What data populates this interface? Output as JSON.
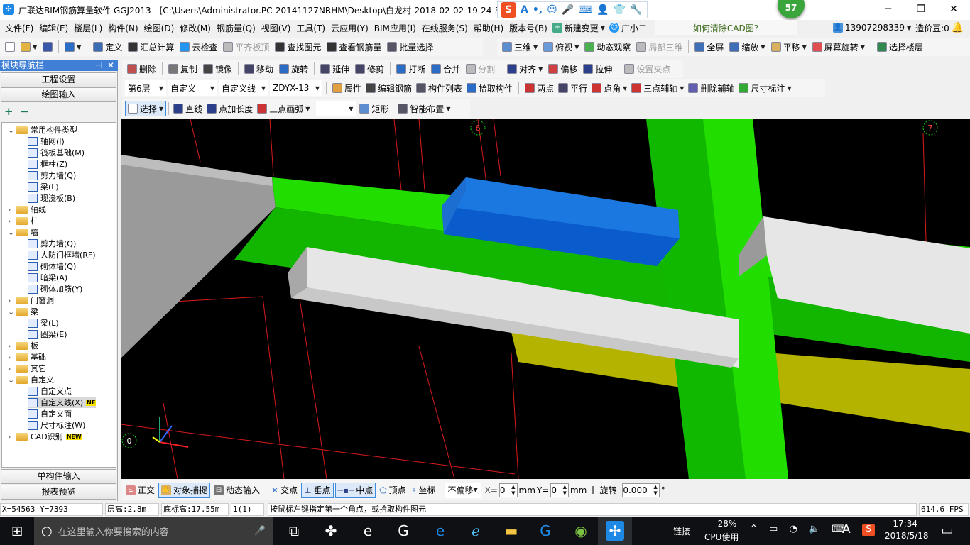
{
  "window": {
    "title": "广联达BIM钢筋算量软件 GGJ2013 - [C:\\Users\\Administrator.PC-20141127NRHM\\Desktop\\白龙村-2018-02-02-19-24-35",
    "minimize": "─",
    "restore": "❐",
    "close": "✕",
    "badge": "57"
  },
  "ime": {
    "items": [
      "S",
      "A",
      "•,",
      "☺",
      "🎤",
      "⌨",
      "👤",
      "👕",
      "🔧"
    ]
  },
  "menu": [
    "文件(F)",
    "编辑(E)",
    "楼层(L)",
    "构件(N)",
    "绘图(D)",
    "修改(M)",
    "钢筋量(Q)",
    "视图(V)",
    "工具(T)",
    "云应用(Y)",
    "BIM应用(I)",
    "在线服务(S)",
    "帮助(H)",
    "版本号(B)"
  ],
  "menu_extra": {
    "new_change": "新建变更",
    "assistant": "广小二",
    "help_link": "如何清除CAD图?",
    "phone": "13907298339",
    "beans": "造价豆:0"
  },
  "toolbar1": [
    {
      "label": "",
      "icon": "new-file-icon",
      "color": "#fff"
    },
    {
      "label": "",
      "icon": "open-folder-icon",
      "color": "#e3b341",
      "dd": true
    },
    {
      "label": "",
      "icon": "save-icon",
      "color": "#3b57a8"
    },
    {
      "sep": true
    },
    {
      "label": "",
      "icon": "undo-icon",
      "color": "#2b6cc4",
      "dd": true
    },
    {
      "sep": true
    },
    {
      "label": "定义",
      "icon": "define-icon",
      "color": "#3b6db5"
    },
    {
      "label": "汇总计算",
      "icon": "sigma-icon",
      "color": "#333"
    },
    {
      "label": "云检查",
      "icon": "cloud-check-icon",
      "color": "#2196f3"
    },
    {
      "label": "平齐板顶",
      "icon": "align-slab-icon",
      "color": "#bbb",
      "dis": true
    },
    {
      "label": "查找图元",
      "icon": "binoculars-icon",
      "color": "#333"
    },
    {
      "label": "查看钢筋量",
      "icon": "rebar-view-icon",
      "color": "#333"
    },
    {
      "label": "批量选择",
      "icon": "batch-select-icon",
      "color": "#556"
    }
  ],
  "toolbar1b": [
    {
      "label": "三维",
      "icon": "3d-box-icon",
      "color": "#5a8ed0",
      "dd": true
    },
    {
      "label": "俯视",
      "icon": "top-view-icon",
      "color": "#6a9bd8",
      "dd": true
    },
    {
      "label": "动态观察",
      "icon": "orbit-icon",
      "color": "#4caf50"
    },
    {
      "label": "局部三维",
      "icon": "local-3d-icon",
      "color": "#bbb",
      "dis": true
    },
    {
      "sep": true
    },
    {
      "label": "全屏",
      "icon": "fullscreen-icon",
      "color": "#3f6fb6"
    },
    {
      "label": "缩放",
      "icon": "zoom-icon",
      "color": "#3f6fb6",
      "dd": true
    },
    {
      "label": "平移",
      "icon": "pan-icon",
      "color": "#d8b060",
      "dd": true
    },
    {
      "label": "屏幕旋转",
      "icon": "rotate-screen-icon",
      "color": "#e05050",
      "dd": true
    },
    {
      "sep": true
    },
    {
      "label": "选择楼层",
      "icon": "select-floor-icon",
      "color": "#2f8a4f"
    }
  ],
  "toolbar2": [
    {
      "label": "删除",
      "icon": "delete-icon",
      "color": "#c05050"
    },
    {
      "sep": true
    },
    {
      "label": "复制",
      "icon": "copy-icon",
      "color": "#777"
    },
    {
      "label": "镜像",
      "icon": "mirror-icon",
      "color": "#444"
    },
    {
      "sep": true
    },
    {
      "label": "移动",
      "icon": "move-icon",
      "color": "#446"
    },
    {
      "label": "旋转",
      "icon": "rotate-icon",
      "color": "#2b6cc4"
    },
    {
      "sep": true
    },
    {
      "label": "延伸",
      "icon": "extend-icon",
      "color": "#446"
    },
    {
      "label": "修剪",
      "icon": "trim-icon",
      "color": "#446"
    },
    {
      "sep": true
    },
    {
      "label": "打断",
      "icon": "break-icon",
      "color": "#2b6cc4"
    },
    {
      "label": "合并",
      "icon": "merge-icon",
      "color": "#2b6cc4"
    },
    {
      "label": "分割",
      "icon": "split-icon",
      "color": "#bbb",
      "dis": true
    },
    {
      "sep": true
    },
    {
      "label": "对齐",
      "icon": "align-icon",
      "color": "#2b3f8a",
      "dd": true
    },
    {
      "label": "偏移",
      "icon": "offset-icon",
      "color": "#d04040"
    },
    {
      "label": "拉伸",
      "icon": "stretch-icon",
      "color": "#2b3f8a"
    },
    {
      "sep": true
    },
    {
      "label": "设置夹点",
      "icon": "grip-icon",
      "color": "#bbb",
      "dis": true
    }
  ],
  "toolbar3": {
    "floor": "第6层",
    "category": "自定义",
    "type": "自定义线",
    "component": "ZDYX-13",
    "items": [
      {
        "label": "属性",
        "icon": "properties-icon",
        "color": "#e0a040"
      },
      {
        "label": "编辑钢筋",
        "icon": "edit-rebar-icon",
        "color": "#444"
      },
      {
        "label": "构件列表",
        "icon": "component-list-icon",
        "color": "#556"
      },
      {
        "label": "拾取构件",
        "icon": "pick-component-icon",
        "color": "#2b6cc4"
      }
    ],
    "axis_items": [
      {
        "label": "两点",
        "icon": "two-point-axis-icon",
        "color": "#c33"
      },
      {
        "label": "平行",
        "icon": "parallel-axis-icon",
        "color": "#446"
      },
      {
        "label": "点角",
        "icon": "point-angle-axis-icon",
        "color": "#c33",
        "dd": true
      },
      {
        "label": "三点辅轴",
        "icon": "three-point-axis-icon",
        "color": "#c33",
        "dd": true
      },
      {
        "label": "删除辅轴",
        "icon": "delete-axis-icon",
        "color": "#6060b0"
      },
      {
        "label": "尺寸标注",
        "icon": "dimension-icon",
        "color": "#3a3",
        "dd": true
      }
    ]
  },
  "toolbar4": [
    {
      "label": "选择",
      "icon": "pointer-icon",
      "color": "#fff",
      "sel": true,
      "dd": true
    },
    {
      "sep": true
    },
    {
      "label": "直线",
      "icon": "line-icon",
      "color": "#2b3f8a"
    },
    {
      "label": "点加长度",
      "icon": "point-length-icon",
      "color": "#2b3f8a"
    },
    {
      "label": "三点画弧",
      "icon": "arc-icon",
      "color": "#c33",
      "dd": true
    }
  ],
  "toolbar4b": [
    {
      "label": "矩形",
      "icon": "rectangle-icon",
      "color": "#5a8ed0"
    },
    {
      "sep": true
    },
    {
      "label": "智能布置",
      "icon": "smart-layout-icon",
      "color": "#556",
      "dd": true
    }
  ],
  "nav": {
    "title": "模块导航栏",
    "pin": "⊣",
    "close": "✕",
    "project_settings": "工程设置",
    "drawing_input": "绘图输入",
    "single_input": "单构件输入",
    "report_preview": "报表预览",
    "expand": "+",
    "collapse": "−"
  },
  "tree": [
    {
      "label": "常用构件类型",
      "lvl": 0,
      "open": true,
      "folder": true
    },
    {
      "label": "轴网(J)",
      "lvl": 1
    },
    {
      "label": "筏板基础(M)",
      "lvl": 1
    },
    {
      "label": "框柱(Z)",
      "lvl": 1
    },
    {
      "label": "剪力墙(Q)",
      "lvl": 1
    },
    {
      "label": "梁(L)",
      "lvl": 1
    },
    {
      "label": "现浇板(B)",
      "lvl": 1
    },
    {
      "label": "轴线",
      "lvl": 0,
      "folder": true
    },
    {
      "label": "柱",
      "lvl": 0,
      "folder": true
    },
    {
      "label": "墙",
      "lvl": 0,
      "open": true,
      "folder": true
    },
    {
      "label": "剪力墙(Q)",
      "lvl": 1
    },
    {
      "label": "人防门框墙(RF)",
      "lvl": 1
    },
    {
      "label": "砌体墙(Q)",
      "lvl": 1
    },
    {
      "label": "暗梁(A)",
      "lvl": 1
    },
    {
      "label": "砌体加筋(Y)",
      "lvl": 1
    },
    {
      "label": "门窗洞",
      "lvl": 0,
      "folder": true
    },
    {
      "label": "梁",
      "lvl": 0,
      "open": true,
      "folder": true
    },
    {
      "label": "梁(L)",
      "lvl": 1
    },
    {
      "label": "圈梁(E)",
      "lvl": 1
    },
    {
      "label": "板",
      "lvl": 0,
      "folder": true
    },
    {
      "label": "基础",
      "lvl": 0,
      "folder": true
    },
    {
      "label": "其它",
      "lvl": 0,
      "folder": true
    },
    {
      "label": "自定义",
      "lvl": 0,
      "open": true,
      "folder": true
    },
    {
      "label": "自定义点",
      "lvl": 1
    },
    {
      "label": "自定义线(X)",
      "lvl": 1,
      "selected": true,
      "tag": "NE"
    },
    {
      "label": "自定义面",
      "lvl": 1
    },
    {
      "label": "尺寸标注(W)",
      "lvl": 1
    },
    {
      "label": "CAD识别",
      "lvl": 0,
      "folder": true,
      "tag": "NEW"
    }
  ],
  "viewport": {
    "axis_labels": [
      "6",
      "7",
      "0"
    ],
    "colors": {
      "background": "#000000",
      "beam": "#22dd00",
      "column": "#11bb00",
      "selected": "#1a78e0",
      "white_beam": "#e6e6e6",
      "slab": "#b8b800",
      "grid": "#ff2020"
    }
  },
  "snap": {
    "ortho": "正交",
    "object_snap": "对象捕捉",
    "dynamic_input": "动态输入",
    "intersection": "交点",
    "perpendicular": "垂点",
    "midpoint": "中点",
    "vertex": "顶点",
    "coordinate": "坐标",
    "offset_mode": "不偏移",
    "x_label": "X=",
    "x_value": "0",
    "unit1": "mm",
    "y_label": "Y=",
    "y_value": "0",
    "unit2": "mm",
    "rotate_label": "旋转",
    "rotate_value": "0.000",
    "degree": "°"
  },
  "status": {
    "coords": "X=54563 Y=7393",
    "floor_height": "层高:2.8m",
    "base_elev": "底标高:17.55m",
    "count": "1(1)",
    "hint": "按鼠标左键指定第一个角点，或拾取构件图元",
    "fps": "614.6 FPS"
  },
  "taskbar": {
    "search_placeholder": "在这里输入你要搜索的内容",
    "link": "链接",
    "cpu": "28%",
    "cpu_label": "CPU使用",
    "time": "17:34",
    "date": "2018/5/18",
    "ime": "A"
  }
}
